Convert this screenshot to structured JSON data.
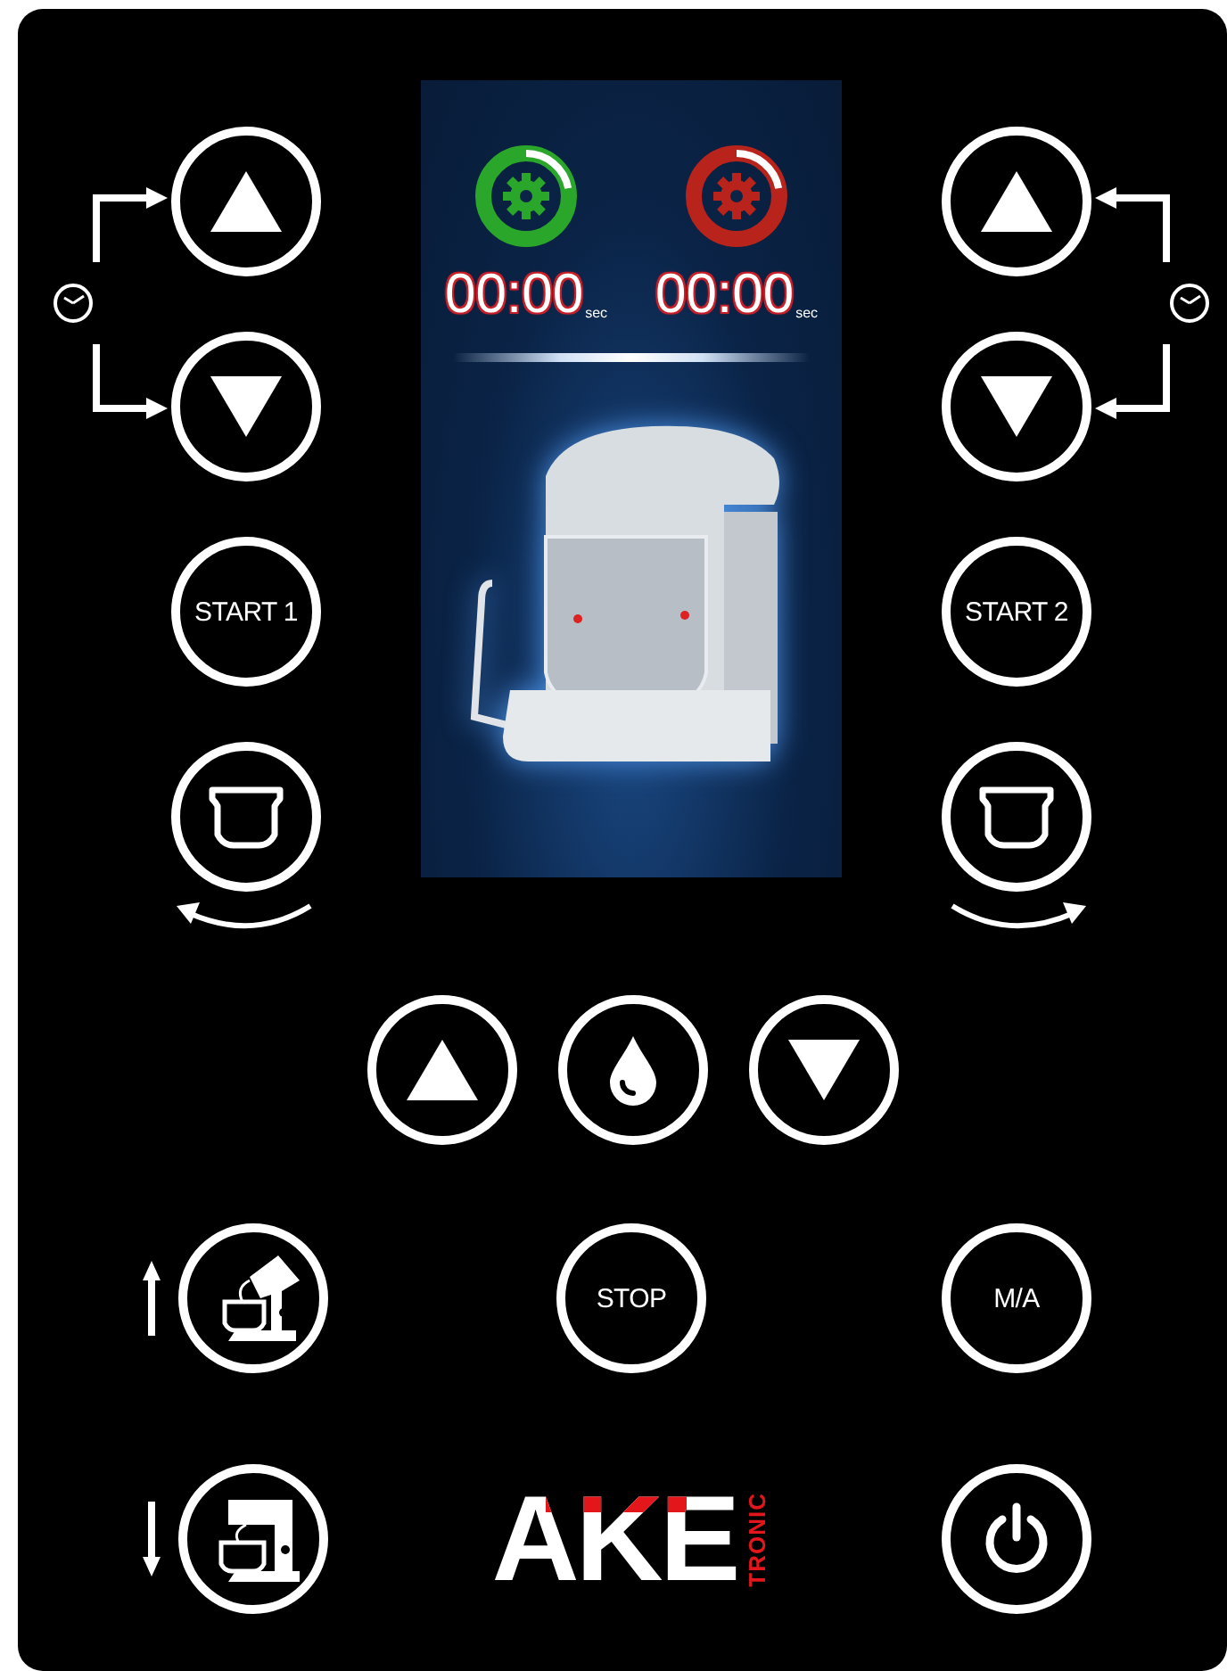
{
  "display": {
    "timers": [
      {
        "value": "00:00",
        "unit": "sec",
        "color": "#2aa72a",
        "level": 0.22
      },
      {
        "value": "00:00",
        "unit": "sec",
        "color": "#b8231b",
        "level": 0.22
      }
    ]
  },
  "left_column": [
    {
      "kind": "up"
    },
    {
      "kind": "down"
    },
    {
      "kind": "text",
      "label": "START 1"
    },
    {
      "kind": "bowl-ccw"
    }
  ],
  "right_column": [
    {
      "kind": "up"
    },
    {
      "kind": "down"
    },
    {
      "kind": "text",
      "label": "START 2"
    },
    {
      "kind": "bowl-cw"
    }
  ],
  "middle_row": [
    {
      "kind": "up"
    },
    {
      "kind": "drop"
    },
    {
      "kind": "down"
    }
  ],
  "bottom_left": [
    {
      "kind": "head-up"
    },
    {
      "kind": "head-down"
    }
  ],
  "bottom_center": [
    {
      "kind": "text",
      "label": "STOP"
    }
  ],
  "bottom_right": [
    {
      "kind": "text",
      "label": "M/A"
    },
    {
      "kind": "power"
    }
  ],
  "logo": {
    "text": "AKE",
    "subtext": "TRONIC"
  }
}
